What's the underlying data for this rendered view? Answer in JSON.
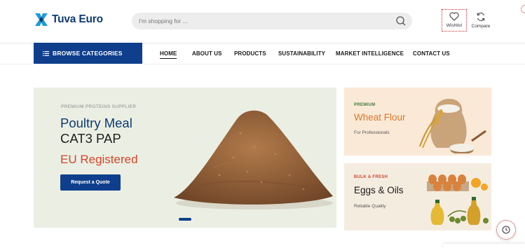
{
  "brand": {
    "name": "Tuva Euro",
    "primary_color": "#0f3f8c",
    "accent_color": "#d6452a"
  },
  "search": {
    "placeholder": "I'm shopping for ..."
  },
  "header_actions": {
    "wishlist_label": "Wishlist",
    "compare_label": "Compare"
  },
  "browse": {
    "label": "BROWSE CATEGORIES"
  },
  "nav": {
    "items": [
      {
        "label": "HOME",
        "active": true
      },
      {
        "label": "ABOUT US"
      },
      {
        "label": "PRODUCTS"
      },
      {
        "label": "SUSTAINABILITY"
      },
      {
        "label": "MARKET INTELLIGENCE"
      },
      {
        "label": "CONTACT US"
      }
    ]
  },
  "hero": {
    "eyebrow": "PREMIUM PROTEINS SUPPLIER",
    "title_line1": "Poultry Meal",
    "title_line2": "CAT3 PAP",
    "title_line3": "EU Registered",
    "cta": "Request a Quote",
    "image": "poultry-meal-pile"
  },
  "promo_cards": [
    {
      "eyebrow": "PREMIUM",
      "title": "Wheat Flour",
      "subtitle": "For Professionals",
      "eyebrow_color": "#3d7a3a",
      "title_color": "#d9782a",
      "image": "flour-sack-and-wheat"
    },
    {
      "eyebrow": "BULK & FRESH",
      "title": "Eggs & Oils",
      "subtitle": "Reliable Quality",
      "eyebrow_color": "#d6452a",
      "title_color": "#1a1a1a",
      "image": "eggs-and-oil-bottles"
    }
  ]
}
